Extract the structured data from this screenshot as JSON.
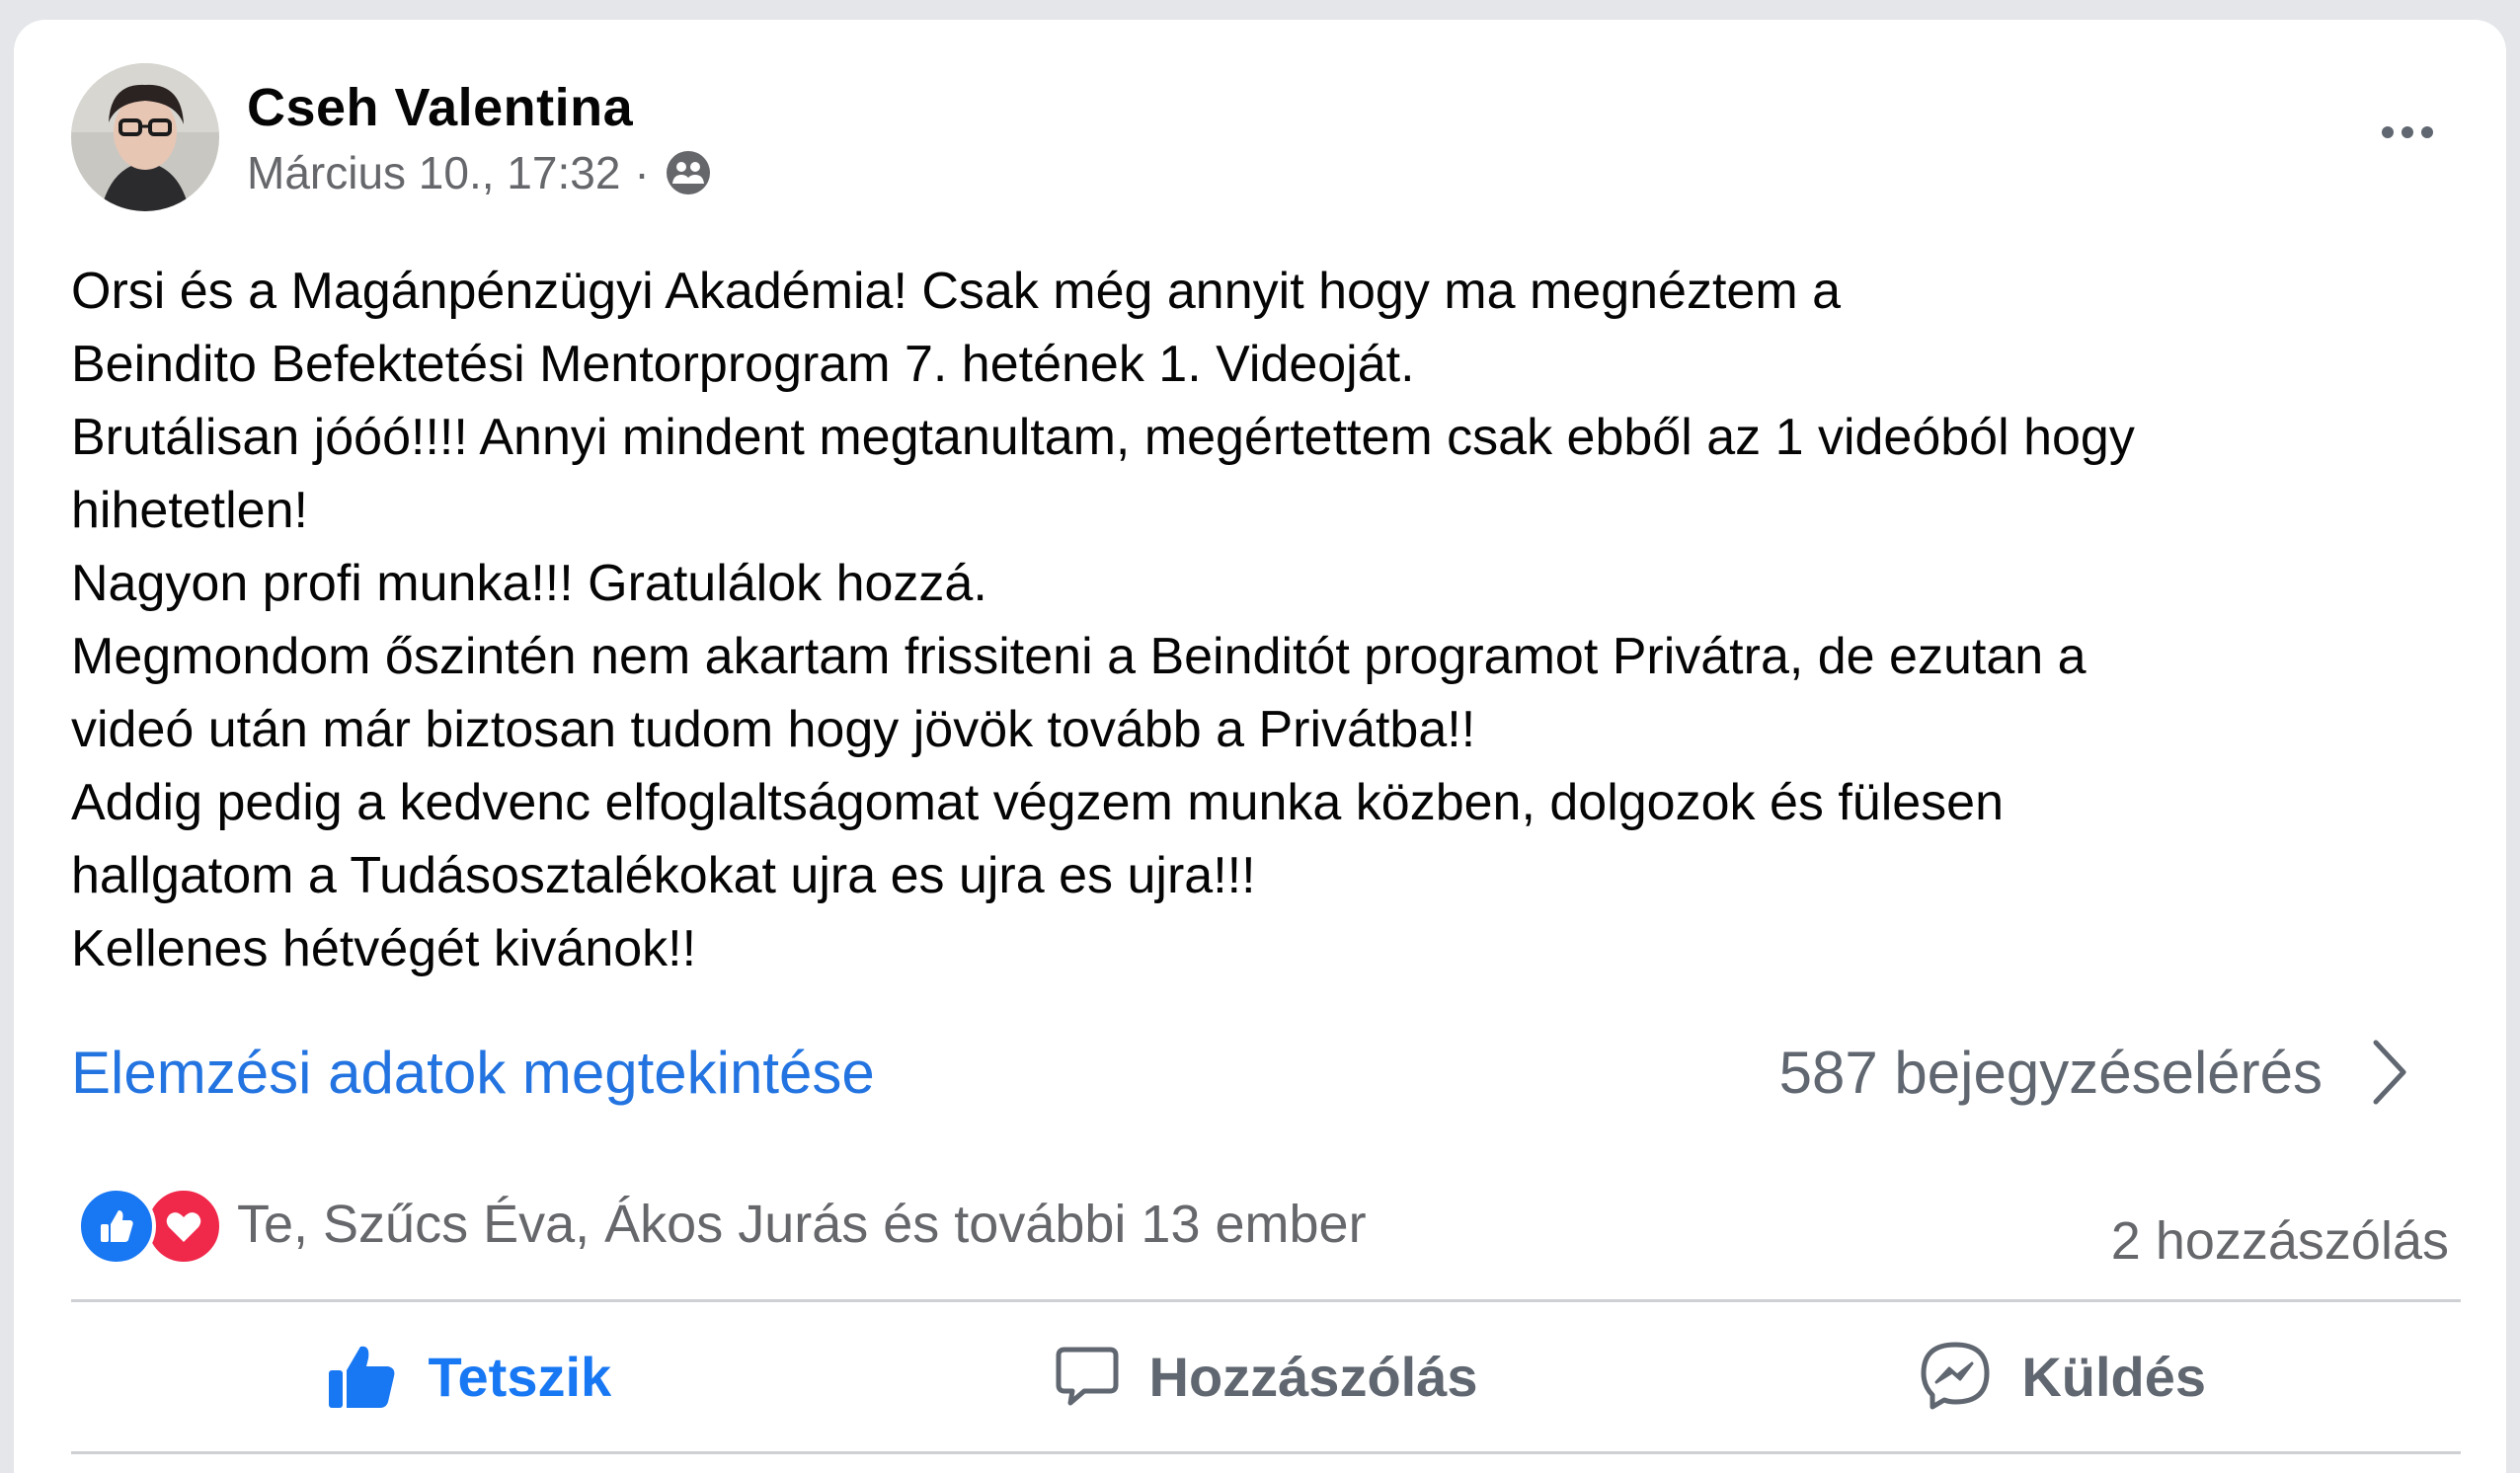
{
  "post": {
    "author": "Cseh Valentina",
    "timestamp": "Március 10., 17:32",
    "separator": "·",
    "audience_icon": "friends-icon",
    "lines": [
      "Orsi és a Magánpénzügyi Akadémia! Csak még annyit hogy ma megnéztem a",
      "Beindito Befektetési Mentorprogram 7. hetének 1. Videoját.",
      "Brutálisan jóóó!!!! Annyi mindent megtanultam, megértettem csak ebből az 1 videóból hogy",
      "hihetetlen!",
      "Nagyon profi munka!!! Gratulálok hozzá.",
      "Megmondom őszintén nem akartam frissiteni a Beinditót programot Privátra, de ezutan a",
      "videó után már biztosan tudom hogy jövök tovább a Privátba!!",
      "Addig pedig a kedvenc elfoglaltságomat végzem munka közben, dolgozok és fülesen",
      "hallgatom a Tudásosztalékokat ujra es ujra es ujra!!!",
      "Kellenes hétvégét kivánok!!"
    ]
  },
  "insights": {
    "link_label": "Elemzési adatok megtekintése",
    "engagement": "587 bejegyzéselérés"
  },
  "reactions": {
    "names": "Te, Szűcs Éva, Ákos Jurás és további 13 ember",
    "comments": "2 hozzászólás"
  },
  "actions": {
    "like": "Tetszik",
    "comment": "Hozzászólás",
    "send": "Küldés"
  },
  "colors": {
    "accent": "#1877f2",
    "link": "#2374e1",
    "secondary_text": "#65676b",
    "love": "#f0284a"
  }
}
